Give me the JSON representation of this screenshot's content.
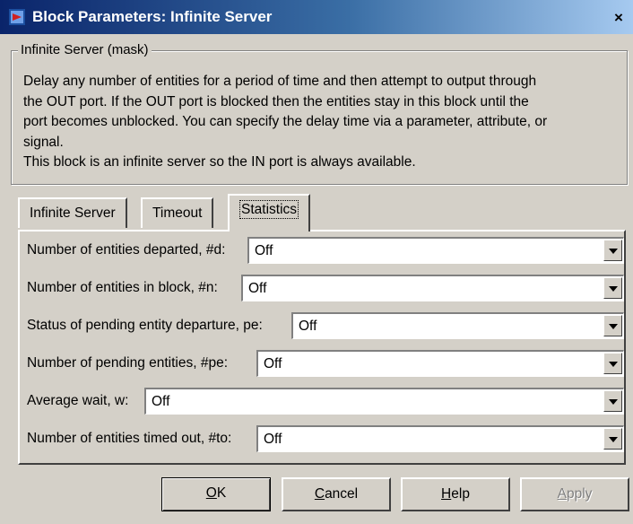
{
  "window": {
    "title": "Block Parameters: Infinite Server",
    "close_label": "×"
  },
  "group": {
    "legend": "Infinite Server (mask)",
    "description_lines": [
      "Delay any number of entities for a period of time and then attempt to output through",
      "the OUT port. If the OUT port is blocked then the entities stay in this block until the",
      "port becomes unblocked. You can specify the delay time via a parameter, attribute, or",
      "signal.",
      "This block is an infinite server so the IN port is always available."
    ]
  },
  "tabs": [
    {
      "label": "Infinite Server"
    },
    {
      "label": "Timeout"
    },
    {
      "label": "Statistics",
      "active": true
    }
  ],
  "fields": [
    {
      "label": "Number of entities departed, #d:",
      "value": "Off"
    },
    {
      "label": "Number of entities in block, #n:",
      "value": "Off"
    },
    {
      "label": "Status of pending entity departure, pe:",
      "value": "Off"
    },
    {
      "label": "Number of  pending entities, #pe:",
      "value": "Off"
    },
    {
      "label": "Average wait, w:",
      "value": "Off"
    },
    {
      "label": "Number of entities timed out, #to:",
      "value": "Off"
    }
  ],
  "buttons": {
    "ok": {
      "mnemonic": "O",
      "rest": "K"
    },
    "cancel": {
      "mnemonic": "C",
      "rest": "ancel"
    },
    "help": {
      "mnemonic": "H",
      "rest": "elp"
    },
    "apply": {
      "mnemonic": "A",
      "rest": "pply",
      "disabled": true
    }
  }
}
